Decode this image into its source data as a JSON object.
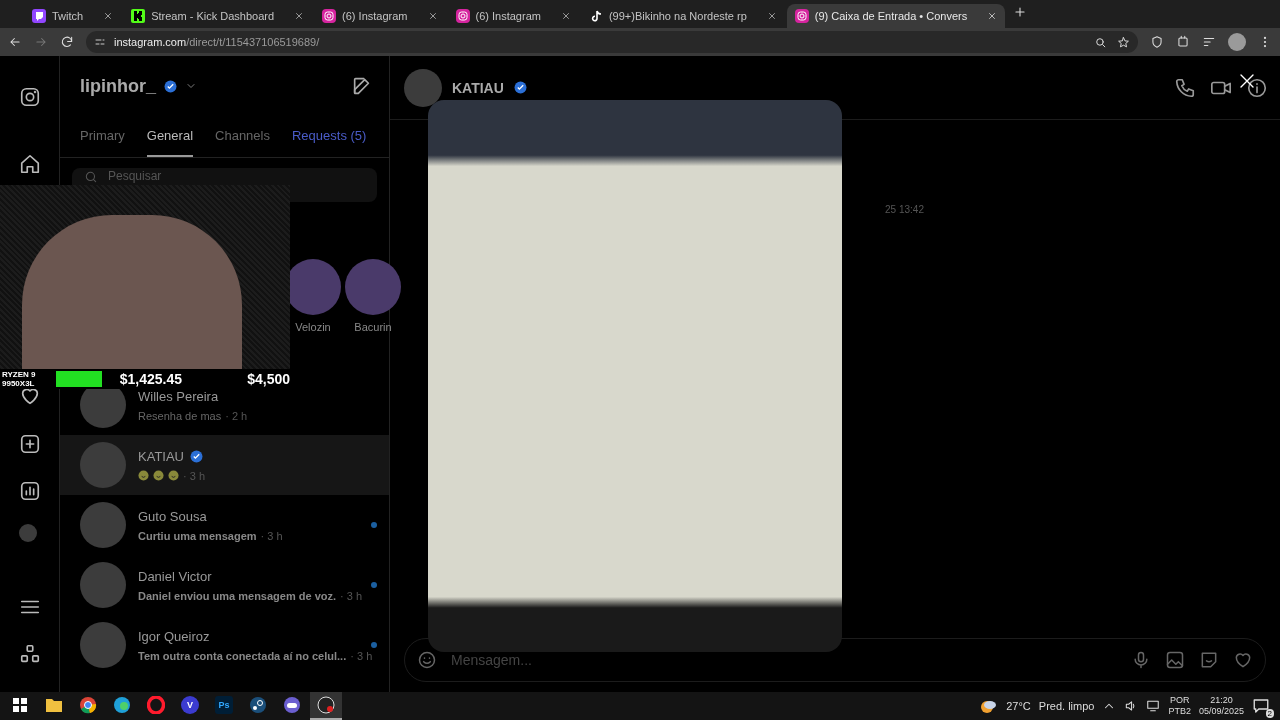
{
  "browser": {
    "tabs": [
      {
        "title": "Twitch",
        "kind": "twitch",
        "selected": false
      },
      {
        "title": "Stream - Kick Dashboard",
        "kind": "kick",
        "selected": false
      },
      {
        "title": "(6) Instagram",
        "kind": "instagram",
        "selected": false
      },
      {
        "title": "(6) Instagram",
        "kind": "instagram",
        "selected": false
      },
      {
        "title": "(99+)Bikinho na Nordeste rp",
        "kind": "tiktok",
        "selected": false
      },
      {
        "title": "(9) Caixa de Entrada • Convers",
        "kind": "instagram",
        "selected": true
      }
    ],
    "url_host": "instagram.com",
    "url_path": "/direct/t/115437106519689/"
  },
  "inbox": {
    "username": "lipinhor_",
    "verified": true,
    "tabs": [
      {
        "label": "Primary",
        "selected": false,
        "accent": false
      },
      {
        "label": "General",
        "selected": true,
        "accent": false
      },
      {
        "label": "Channels",
        "selected": false,
        "accent": false
      },
      {
        "label": "Requests (5)",
        "selected": false,
        "accent": true
      }
    ],
    "search": {
      "placeholder": "Pesquisar"
    },
    "notes": [
      {
        "name": "Velozin"
      },
      {
        "name": "Bacurin"
      }
    ],
    "conversations": [
      {
        "name": "Willes Pereira",
        "verified": false,
        "preview": "Resenha de mas",
        "time": "· 2 h",
        "unread": false,
        "selected": false,
        "kind": "text"
      },
      {
        "name": "KATIAU",
        "verified": true,
        "time": "· 3 h",
        "unread": false,
        "selected": true,
        "kind": "emoji"
      },
      {
        "name": "Guto Sousa",
        "verified": false,
        "preview": "Curtiu uma mensagem",
        "time": "· 3 h",
        "unread": true,
        "selected": false,
        "kind": "text"
      },
      {
        "name": "Daniel Victor",
        "verified": false,
        "preview": "Daniel enviou uma mensagem de voz.",
        "time": "· 3 h",
        "unread": true,
        "selected": false,
        "kind": "text"
      },
      {
        "name": "Igor Queiroz",
        "verified": false,
        "preview": "Tem outra conta conectada aí no celul...",
        "time": "· 3 h",
        "unread": true,
        "selected": false,
        "kind": "text"
      }
    ]
  },
  "chat": {
    "name": "KATIAU",
    "verified": true,
    "timestamp": "25 13:42",
    "composer": {
      "placeholder": "Mensagem..."
    }
  },
  "stream_overlay": {
    "cpu_line1": "RYZEN 9",
    "cpu_line2": "9950X3L",
    "raised": "$1,425.45",
    "goal": "$4,500"
  },
  "taskbar": {
    "apps": [
      {
        "kind": "folder",
        "active": false
      },
      {
        "kind": "chrome",
        "active": false
      },
      {
        "kind": "edge",
        "active": false
      },
      {
        "kind": "opera",
        "active": false
      },
      {
        "kind": "letter",
        "label": "V",
        "active": false
      },
      {
        "kind": "letter",
        "label": "Ps",
        "active": false
      },
      {
        "kind": "steam",
        "active": false
      },
      {
        "kind": "discord",
        "active": false
      },
      {
        "kind": "obs",
        "active": true
      }
    ],
    "temperature": "27°C",
    "condition": "Pred. limpo",
    "language": "POR",
    "layout": "PTB2",
    "time": "21:20",
    "date": "05/09/2025",
    "notifications": "2"
  }
}
